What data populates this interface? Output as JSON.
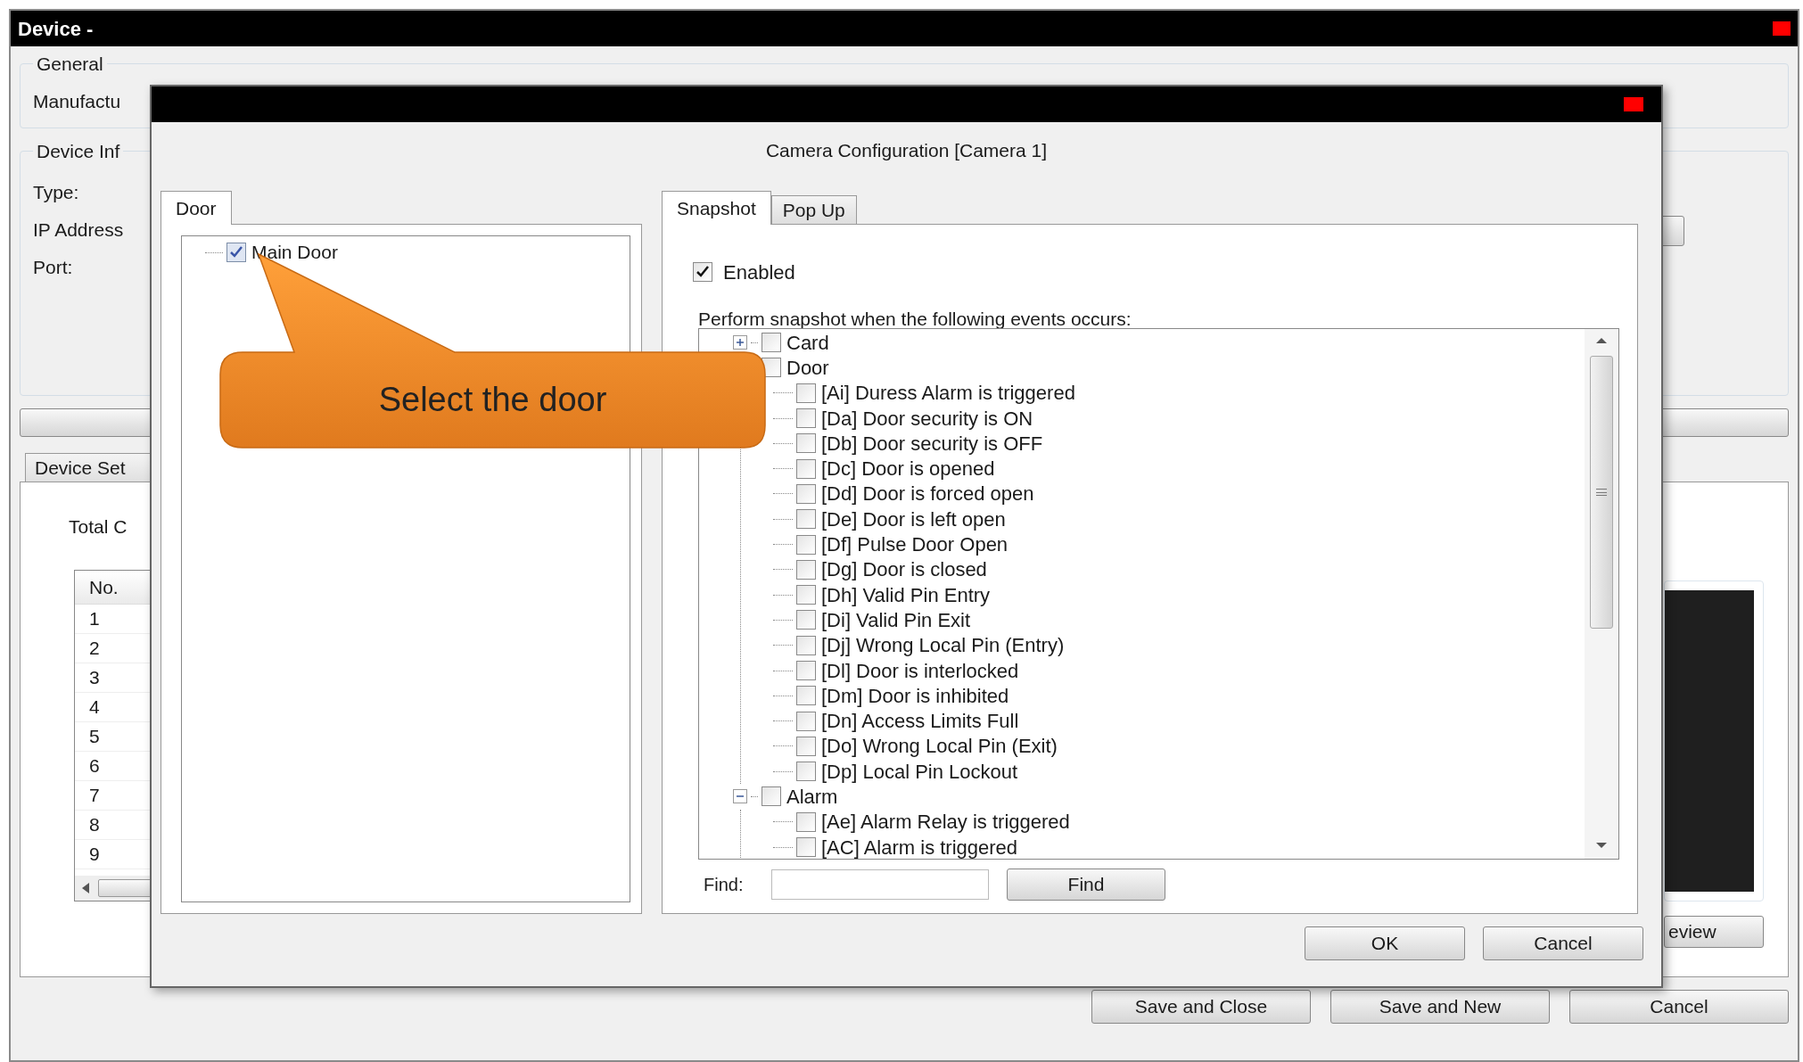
{
  "main_window": {
    "title": "Device -",
    "general": {
      "legend": "General",
      "manufacturer_label": "Manufactu"
    },
    "device_info": {
      "legend": "Device Inf",
      "fields": [
        "Type:",
        "IP Address",
        "Port:"
      ]
    },
    "settings_tab": "Device Set",
    "total_label": "Total C",
    "table": {
      "columns": [
        "No."
      ],
      "rows": [
        "1",
        "2",
        "3",
        "4",
        "5",
        "6",
        "7",
        "8",
        "9"
      ]
    },
    "preview_button": "eview",
    "buttons": [
      "Save and Close",
      "Save and New",
      "Cancel"
    ]
  },
  "dialog": {
    "title": "Camera Configuration [Camera 1]",
    "left_tabs": [
      {
        "label": "Door",
        "selected": true
      }
    ],
    "door_tree": [
      {
        "label": "Main Door",
        "checked": true
      }
    ],
    "right_tabs": [
      {
        "label": "Snapshot",
        "selected": true
      },
      {
        "label": "Pop Up",
        "selected": false
      }
    ],
    "enabled": {
      "label": "Enabled",
      "checked": true
    },
    "events_label": "Perform snapshot when the following events occurs:",
    "event_tree": [
      {
        "label": "Card",
        "checked": false,
        "expanded": false
      },
      {
        "label": "Door",
        "checked": false,
        "children": [
          {
            "label": "[Ai] Duress Alarm is triggered",
            "checked": false
          },
          {
            "label": "[Da] Door security is ON",
            "checked": false
          },
          {
            "label": "[Db] Door security is OFF",
            "checked": false
          },
          {
            "label": "[Dc] Door is opened",
            "checked": false
          },
          {
            "label": "[Dd] Door is forced open",
            "checked": false
          },
          {
            "label": "[De] Door is left open",
            "checked": false
          },
          {
            "label": "[Df] Pulse Door Open",
            "checked": false
          },
          {
            "label": "[Dg] Door is closed",
            "checked": false
          },
          {
            "label": "[Dh] Valid Pin Entry",
            "checked": false
          },
          {
            "label": "[Di] Valid Pin Exit",
            "checked": false
          },
          {
            "label": "[Dj] Wrong Local Pin (Entry)",
            "checked": false
          },
          {
            "label": "[Dl] Door is interlocked",
            "checked": false
          },
          {
            "label": "[Dm] Door is inhibited",
            "checked": false
          },
          {
            "label": "[Dn] Access Limits Full",
            "checked": false
          },
          {
            "label": "[Do] Wrong Local Pin (Exit)",
            "checked": false
          },
          {
            "label": "[Dp] Local Pin Lockout",
            "checked": false
          }
        ]
      },
      {
        "label": "Alarm",
        "checked": false,
        "expanded": true,
        "children": [
          {
            "label": "[Ae] Alarm Relay is triggered",
            "checked": false
          },
          {
            "label": "[AC] Alarm is triggered",
            "checked": false
          }
        ]
      }
    ],
    "find": {
      "label": "Find:",
      "button": "Find"
    },
    "buttons": [
      "OK",
      "Cancel"
    ]
  },
  "callout": {
    "text": "Select the door"
  }
}
